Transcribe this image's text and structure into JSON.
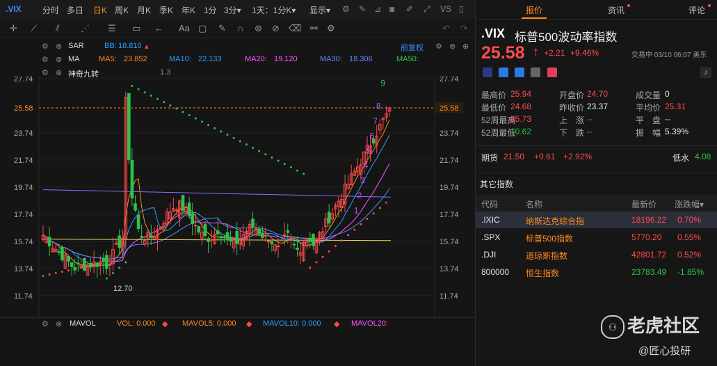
{
  "timeframes": {
    "symbol": ".VIX",
    "items": [
      "分时",
      "多日",
      "日K",
      "周K",
      "月K",
      "季K",
      "年K",
      "1分",
      "3分▾",
      "1天：1分K▾",
      "显示▾"
    ],
    "active_index": 2
  },
  "chart_header": {
    "sar_label": "SAR",
    "bb_label": "BB:",
    "bb_value": "18.810",
    "restore_label": "前复权",
    "ma_label": "MA",
    "ma_items": [
      {
        "label": "MA5:",
        "value": "23.852",
        "color": "#ff8a1d"
      },
      {
        "label": "MA10:",
        "value": "22.133",
        "color": "#2aa0ff"
      },
      {
        "label": "MA20:",
        "value": "19.120",
        "color": "#ff55ff"
      },
      {
        "label": "MA30:",
        "value": "18.306",
        "color": "#5a8cff"
      },
      {
        "label": "MA50:",
        "value": "",
        "color": "#2ec24a"
      }
    ],
    "sequence_label": "神奇九转"
  },
  "axis": {
    "labels": [
      "27.74",
      "25.58",
      "23.74",
      "21.74",
      "19.74",
      "17.74",
      "15.74",
      "13.74",
      "11.74"
    ],
    "current": "25.58",
    "low_label": "12.70",
    "high_label": "1.3"
  },
  "td_labels": {
    "green": [
      "9"
    ],
    "purple": [
      "1",
      "2",
      "3",
      "4",
      "5",
      "6",
      "7",
      "8"
    ]
  },
  "volume_header": {
    "label": "MAVOL",
    "vol": "VOL: 0.000",
    "mavol5": "MAVOL5: 0.000",
    "mavol10": "MAVOL10: 0.000",
    "mavol20": "MAVOL20:"
  },
  "panel": {
    "tabs": [
      {
        "label": "报价",
        "active": true,
        "dot": false
      },
      {
        "label": "资讯",
        "active": false,
        "dot": true
      },
      {
        "label": "评论",
        "active": false,
        "dot": true
      }
    ],
    "symbol": ".VIX",
    "name": "标普500波动率指数",
    "price": "25.58",
    "arrow": "↑",
    "change": "+2.21",
    "change_pct": "+9.46%",
    "status": "交易中 03/10 06:07 美东",
    "stats": [
      {
        "label": "最高价",
        "value": "25.94",
        "cls": "red"
      },
      {
        "label": "开盘价",
        "value": "24.70",
        "cls": "red"
      },
      {
        "label": "成交量",
        "value": "0",
        "cls": "white"
      },
      {
        "label": "最低价",
        "value": "24.68",
        "cls": "red"
      },
      {
        "label": "昨收价",
        "value": "23.37",
        "cls": "white"
      },
      {
        "label": "平均价",
        "value": "25.31",
        "cls": "red"
      },
      {
        "label": "52周最高",
        "value": "65.73",
        "cls": "red"
      },
      {
        "label": "上　涨",
        "value": "--",
        "cls": "red"
      },
      {
        "label": "平　盘",
        "value": "--",
        "cls": "white"
      },
      {
        "label": "52周最低",
        "value": "10.62",
        "cls": "green"
      },
      {
        "label": "下　跌",
        "value": "--",
        "cls": "green"
      },
      {
        "label": "振　幅",
        "value": "5.39%",
        "cls": "white"
      }
    ],
    "futures": {
      "label": "期货",
      "price": "21.50",
      "change": "+0.61",
      "pct": "+2.92%",
      "low_label": "低水",
      "low_value": "4.08"
    },
    "other_title": "其它指数",
    "table_headers": [
      "代码",
      "名称",
      "最新价",
      "涨跌幅▾"
    ],
    "rows": [
      {
        "code": ".IXIC",
        "name": "纳斯达克综合指",
        "price": "18196.22",
        "pct": "0.70%",
        "cls": "red"
      },
      {
        "code": ".SPX",
        "name": "标普500指数",
        "price": "5770.20",
        "pct": "0.55%",
        "cls": "red"
      },
      {
        "code": ".DJI",
        "name": "道琼斯指数",
        "price": "42801.72",
        "pct": "0.52%",
        "cls": "red"
      },
      {
        "code": "800000",
        "name": "恒生指数",
        "price": "23783.49",
        "pct": "-1.85%",
        "cls": "green"
      }
    ],
    "watermark": "老虎社区",
    "credit": "@匠心投研"
  }
}
